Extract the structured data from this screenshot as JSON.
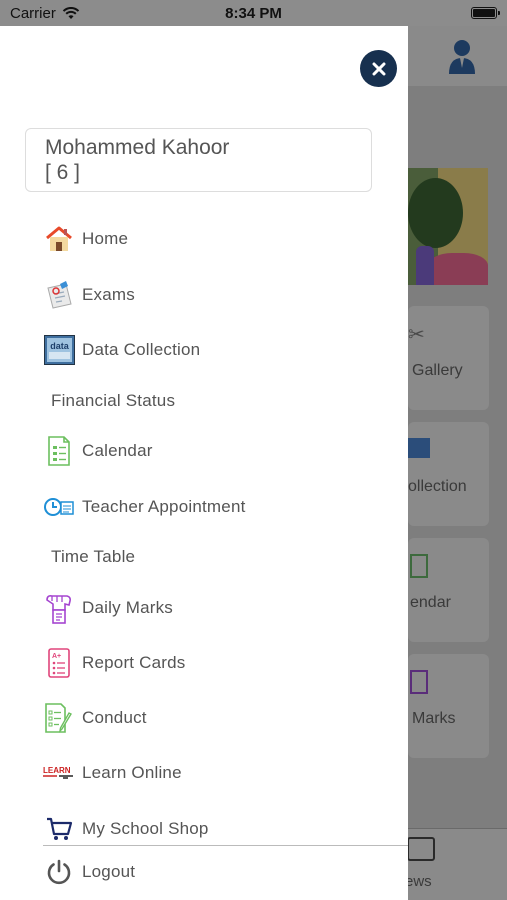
{
  "status_bar": {
    "carrier": "Carrier",
    "time": "8:34 PM"
  },
  "profile": {
    "name": "Mohammed Kahoor",
    "class_label": "[ 6 ]"
  },
  "menu": {
    "home": "Home",
    "exams": "Exams",
    "data_collection": "Data Collection",
    "financial_status": "Financial Status",
    "calendar": "Calendar",
    "teacher_appointment": "Teacher Appointment",
    "time_table": "Time Table",
    "daily_marks": "Daily Marks",
    "report_cards": "Report Cards",
    "conduct": "Conduct",
    "learn_online": "Learn Online",
    "my_school_shop": "My School Shop",
    "logout": "Logout"
  },
  "icons": {
    "learn_online_text": "LEARN",
    "data_collection_text": "data"
  },
  "background": {
    "cards": [
      "Gallery",
      "ollection",
      "endar",
      "Marks"
    ],
    "bottom_tab": "ews"
  },
  "colors": {
    "close_button": "#17304f",
    "drawer_bg": "#ffffff",
    "overlay": "#7e7e7e"
  }
}
